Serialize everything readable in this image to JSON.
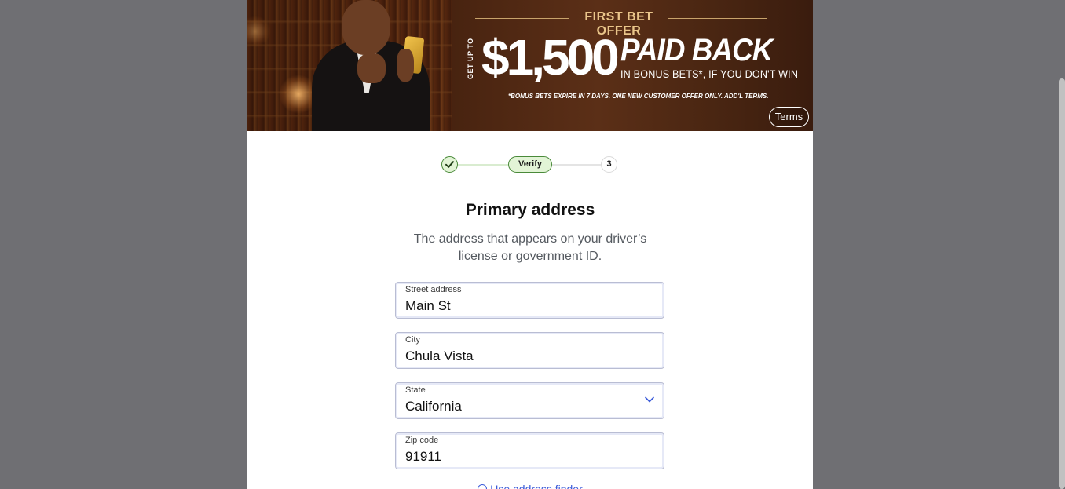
{
  "banner": {
    "offer_title": "FIRST BET OFFER",
    "get_up_to": "GET UP TO",
    "amount": "$1,500",
    "paid_back": "PAID BACK",
    "bonus_line": "IN BONUS BETS*, IF YOU DON'T WIN",
    "disclaimer": "*BONUS BETS EXPIRE IN 7 DAYS. ONE NEW CUSTOMER OFFER ONLY. ADD'L TERMS.",
    "terms_label": "Terms",
    "phone_icon": "phone-icon"
  },
  "stepper": {
    "step1_icon": "check-icon",
    "step2_label": "Verify",
    "step3_label": "3",
    "active_color": "#4a8a3a",
    "active_bg": "#e2f4d6"
  },
  "form": {
    "title": "Primary address",
    "subtitle": "The address that appears on your driver’s license or government ID.",
    "street": {
      "label": "Street address",
      "value": "Main St"
    },
    "city": {
      "label": "City",
      "value": "Chula Vista"
    },
    "state": {
      "label": "State",
      "value": "California",
      "icon": "chevron-down-icon"
    },
    "zip": {
      "label": "Zip code",
      "value": "91911"
    },
    "finder_label": "Use address finder",
    "finder_icon": "info-icon",
    "link_color": "#3b5bd9"
  }
}
